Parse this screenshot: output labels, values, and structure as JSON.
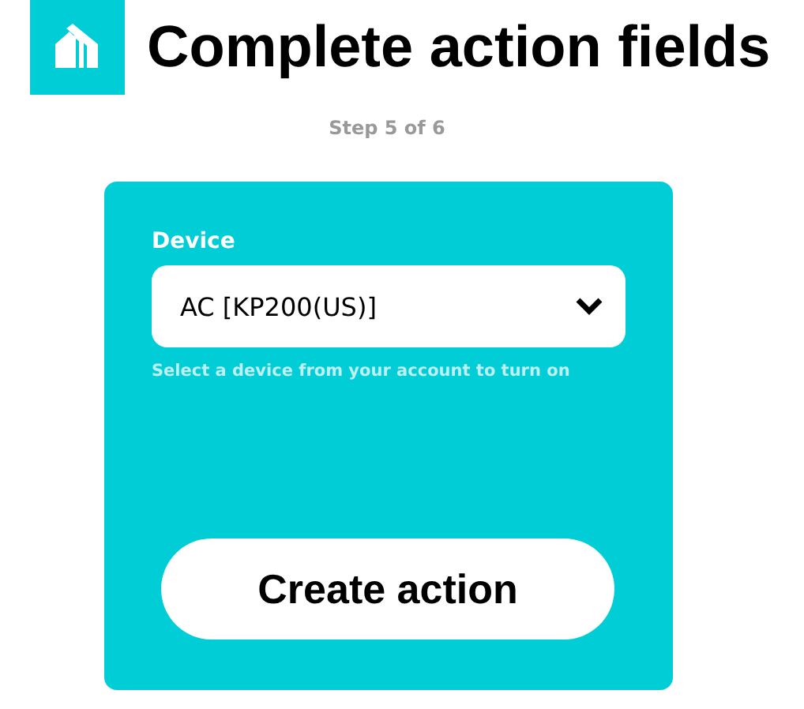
{
  "header": {
    "title": "Complete action fields",
    "step": "Step 5 of 6"
  },
  "form": {
    "field": {
      "label": "Device",
      "value": "AC [KP200(US)]",
      "hint": "Select a device from your account to turn on"
    },
    "submit": "Create action"
  }
}
